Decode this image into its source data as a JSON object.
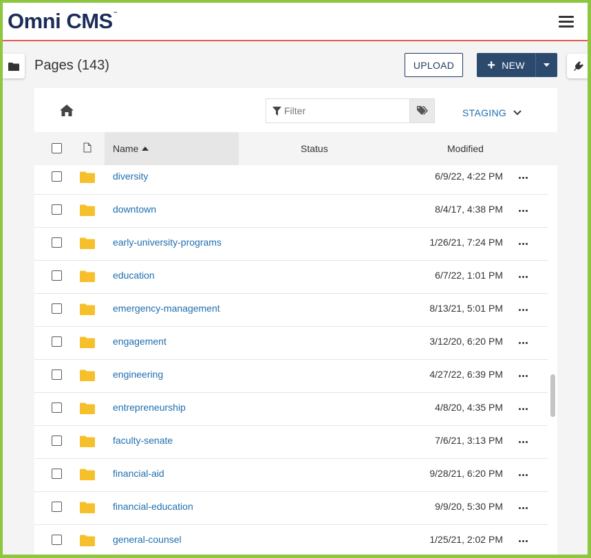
{
  "app": {
    "logo": "Omni CMS",
    "logo_tm": "™"
  },
  "page": {
    "title": "Pages (143)"
  },
  "toolbar": {
    "upload_label": "UPLOAD",
    "new_label": "NEW",
    "new_plus": "+"
  },
  "filter": {
    "placeholder": "Filter",
    "value": ""
  },
  "environment": {
    "label": "STAGING"
  },
  "table": {
    "columns": {
      "name": "Name",
      "status": "Status",
      "modified": "Modified"
    },
    "rows": [
      {
        "name": "diversity",
        "modified": "6/9/22, 4:22 PM"
      },
      {
        "name": "downtown",
        "modified": "8/4/17, 4:38 PM"
      },
      {
        "name": "early-university-programs",
        "modified": "1/26/21, 7:24 PM"
      },
      {
        "name": "education",
        "modified": "6/7/22, 1:01 PM"
      },
      {
        "name": "emergency-management",
        "modified": "8/13/21, 5:01 PM"
      },
      {
        "name": "engagement",
        "modified": "3/12/20, 6:20 PM"
      },
      {
        "name": "engineering",
        "modified": "4/27/22, 6:39 PM"
      },
      {
        "name": "entrepreneurship",
        "modified": "4/8/20, 4:35 PM"
      },
      {
        "name": "faculty-senate",
        "modified": "7/6/21, 3:13 PM"
      },
      {
        "name": "financial-aid",
        "modified": "9/28/21, 6:20 PM"
      },
      {
        "name": "financial-education",
        "modified": "9/9/20, 5:30 PM"
      },
      {
        "name": "general-counsel",
        "modified": "1/25/21, 2:02 PM"
      }
    ]
  },
  "colors": {
    "brand": "#1c2d5a",
    "accent_line": "#e2574c",
    "link": "#1f6fb0",
    "primary_button": "#2c4a6e",
    "folder": "#f5c02b",
    "outer_border": "#8dc63f"
  },
  "icons": [
    "folder-icon",
    "plug-icon",
    "hamburger-icon",
    "home-icon",
    "filter-icon",
    "tag-icon",
    "chevron-down-icon",
    "file-icon",
    "sort-asc-icon",
    "more-icon",
    "caret-down-icon"
  ]
}
